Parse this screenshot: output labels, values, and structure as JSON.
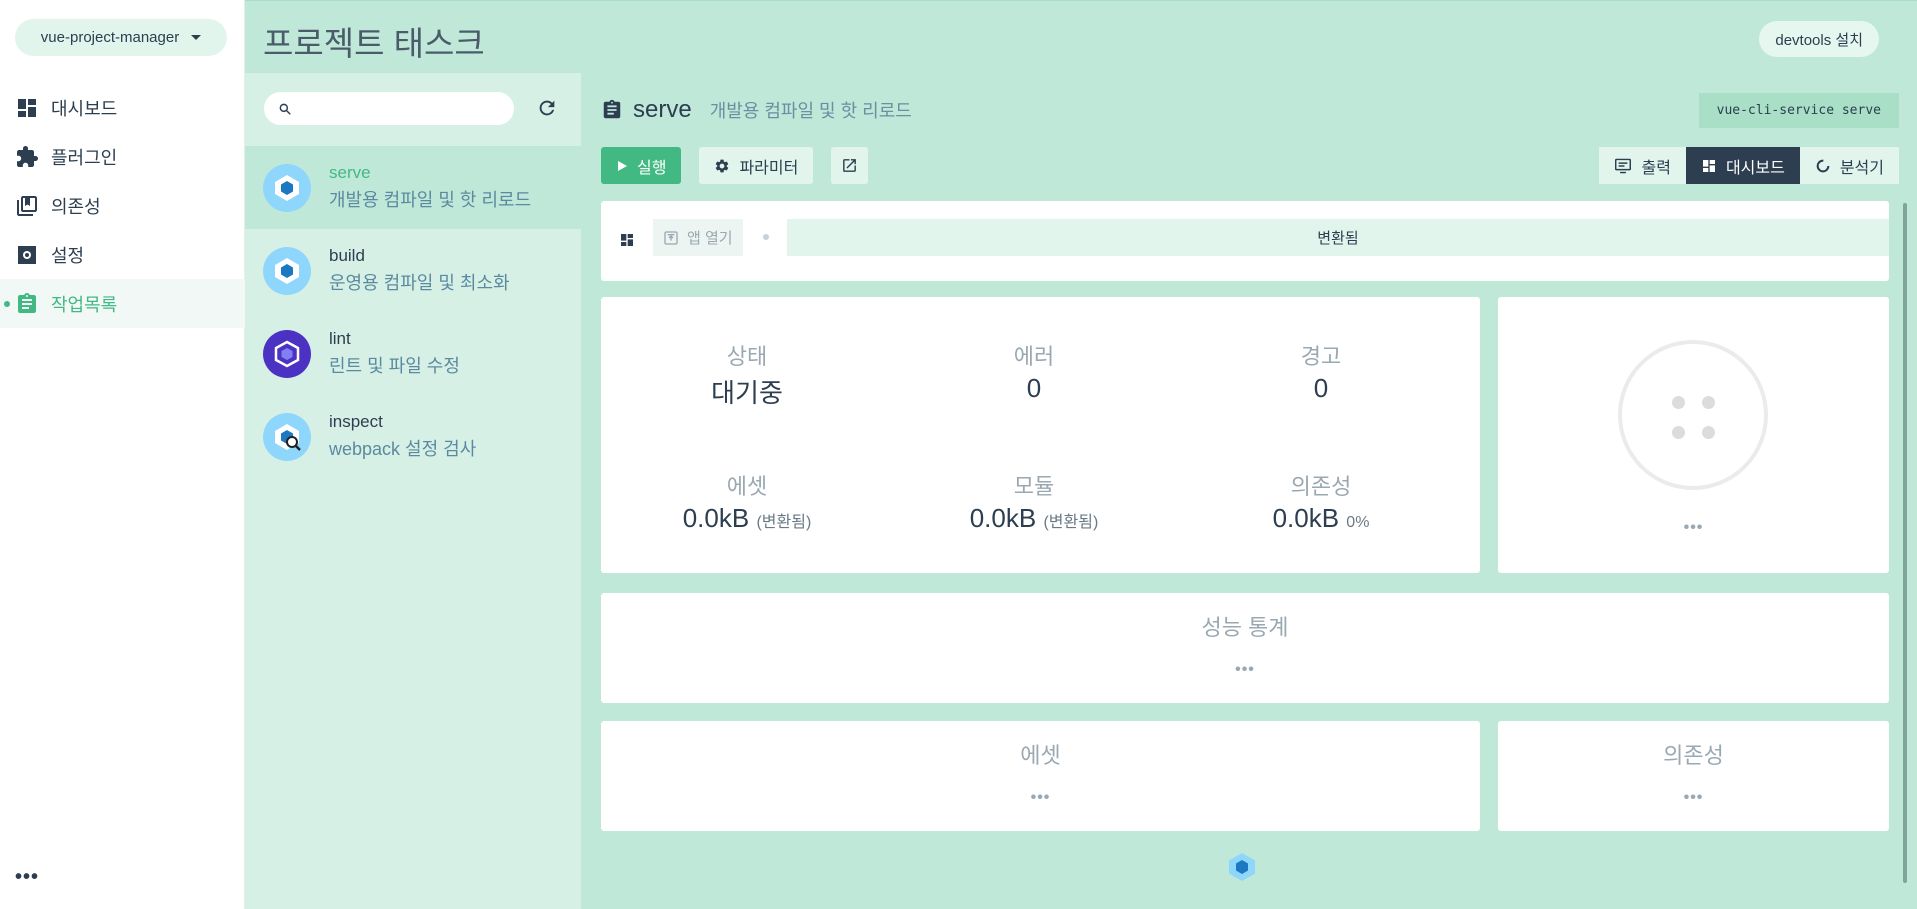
{
  "nav": {
    "project": "vue-project-manager",
    "items": [
      {
        "label": "대시보드",
        "icon": "dashboard-icon"
      },
      {
        "label": "플러그인",
        "icon": "puzzle-icon"
      },
      {
        "label": "의존성",
        "icon": "library-icon"
      },
      {
        "label": "설정",
        "icon": "gear-icon"
      },
      {
        "label": "작업목록",
        "icon": "clipboard-icon",
        "active": true
      }
    ],
    "more": "•••"
  },
  "header": {
    "title": "프로젝트 태스크",
    "devtools_label": "devtools 설치"
  },
  "tasks": {
    "search_placeholder": "",
    "items": [
      {
        "name": "serve",
        "desc": "개발용 컴파일 및 핫 리로드",
        "active": true
      },
      {
        "name": "build",
        "desc": "운영용 컴파일 및 최소화"
      },
      {
        "name": "lint",
        "desc": "린트 및 파일 수정"
      },
      {
        "name": "inspect",
        "desc": "webpack 설정 검사"
      }
    ]
  },
  "main": {
    "task_name": "serve",
    "task_desc": "개발용 컴파일 및 핫 리로드",
    "command": "vue-cli-service serve",
    "buttons": {
      "run": "실행",
      "params": "파라미터"
    },
    "views": {
      "output": "출력",
      "dashboard": "대시보드",
      "analyzer": "분석기"
    },
    "status_bar": {
      "open_app": "앱 열기",
      "progress_text": "변환됨"
    },
    "stats": {
      "status_label": "상태",
      "status_value": "대기중",
      "errors_label": "에러",
      "errors_value": "0",
      "warnings_label": "경고",
      "warnings_value": "0",
      "assets_label": "에셋",
      "assets_value": "0.0kB",
      "assets_sub": "(변환됨)",
      "modules_label": "모듈",
      "modules_value": "0.0kB",
      "modules_sub": "(변환됨)",
      "deps_label": "의존성",
      "deps_value": "0.0kB",
      "deps_sub": "0%"
    },
    "speed_dots": "•••",
    "perf": {
      "title": "성능 통계",
      "dots": "•••"
    },
    "assets": {
      "title": "에셋",
      "dots": "•••"
    },
    "dependencies": {
      "title": "의존성",
      "dots": "•••"
    }
  },
  "colors": {
    "accent": "#42b983",
    "dark": "#2c3e50",
    "header_bg": "#c0e8d9",
    "task_pane_bg": "#d7f0e6"
  }
}
